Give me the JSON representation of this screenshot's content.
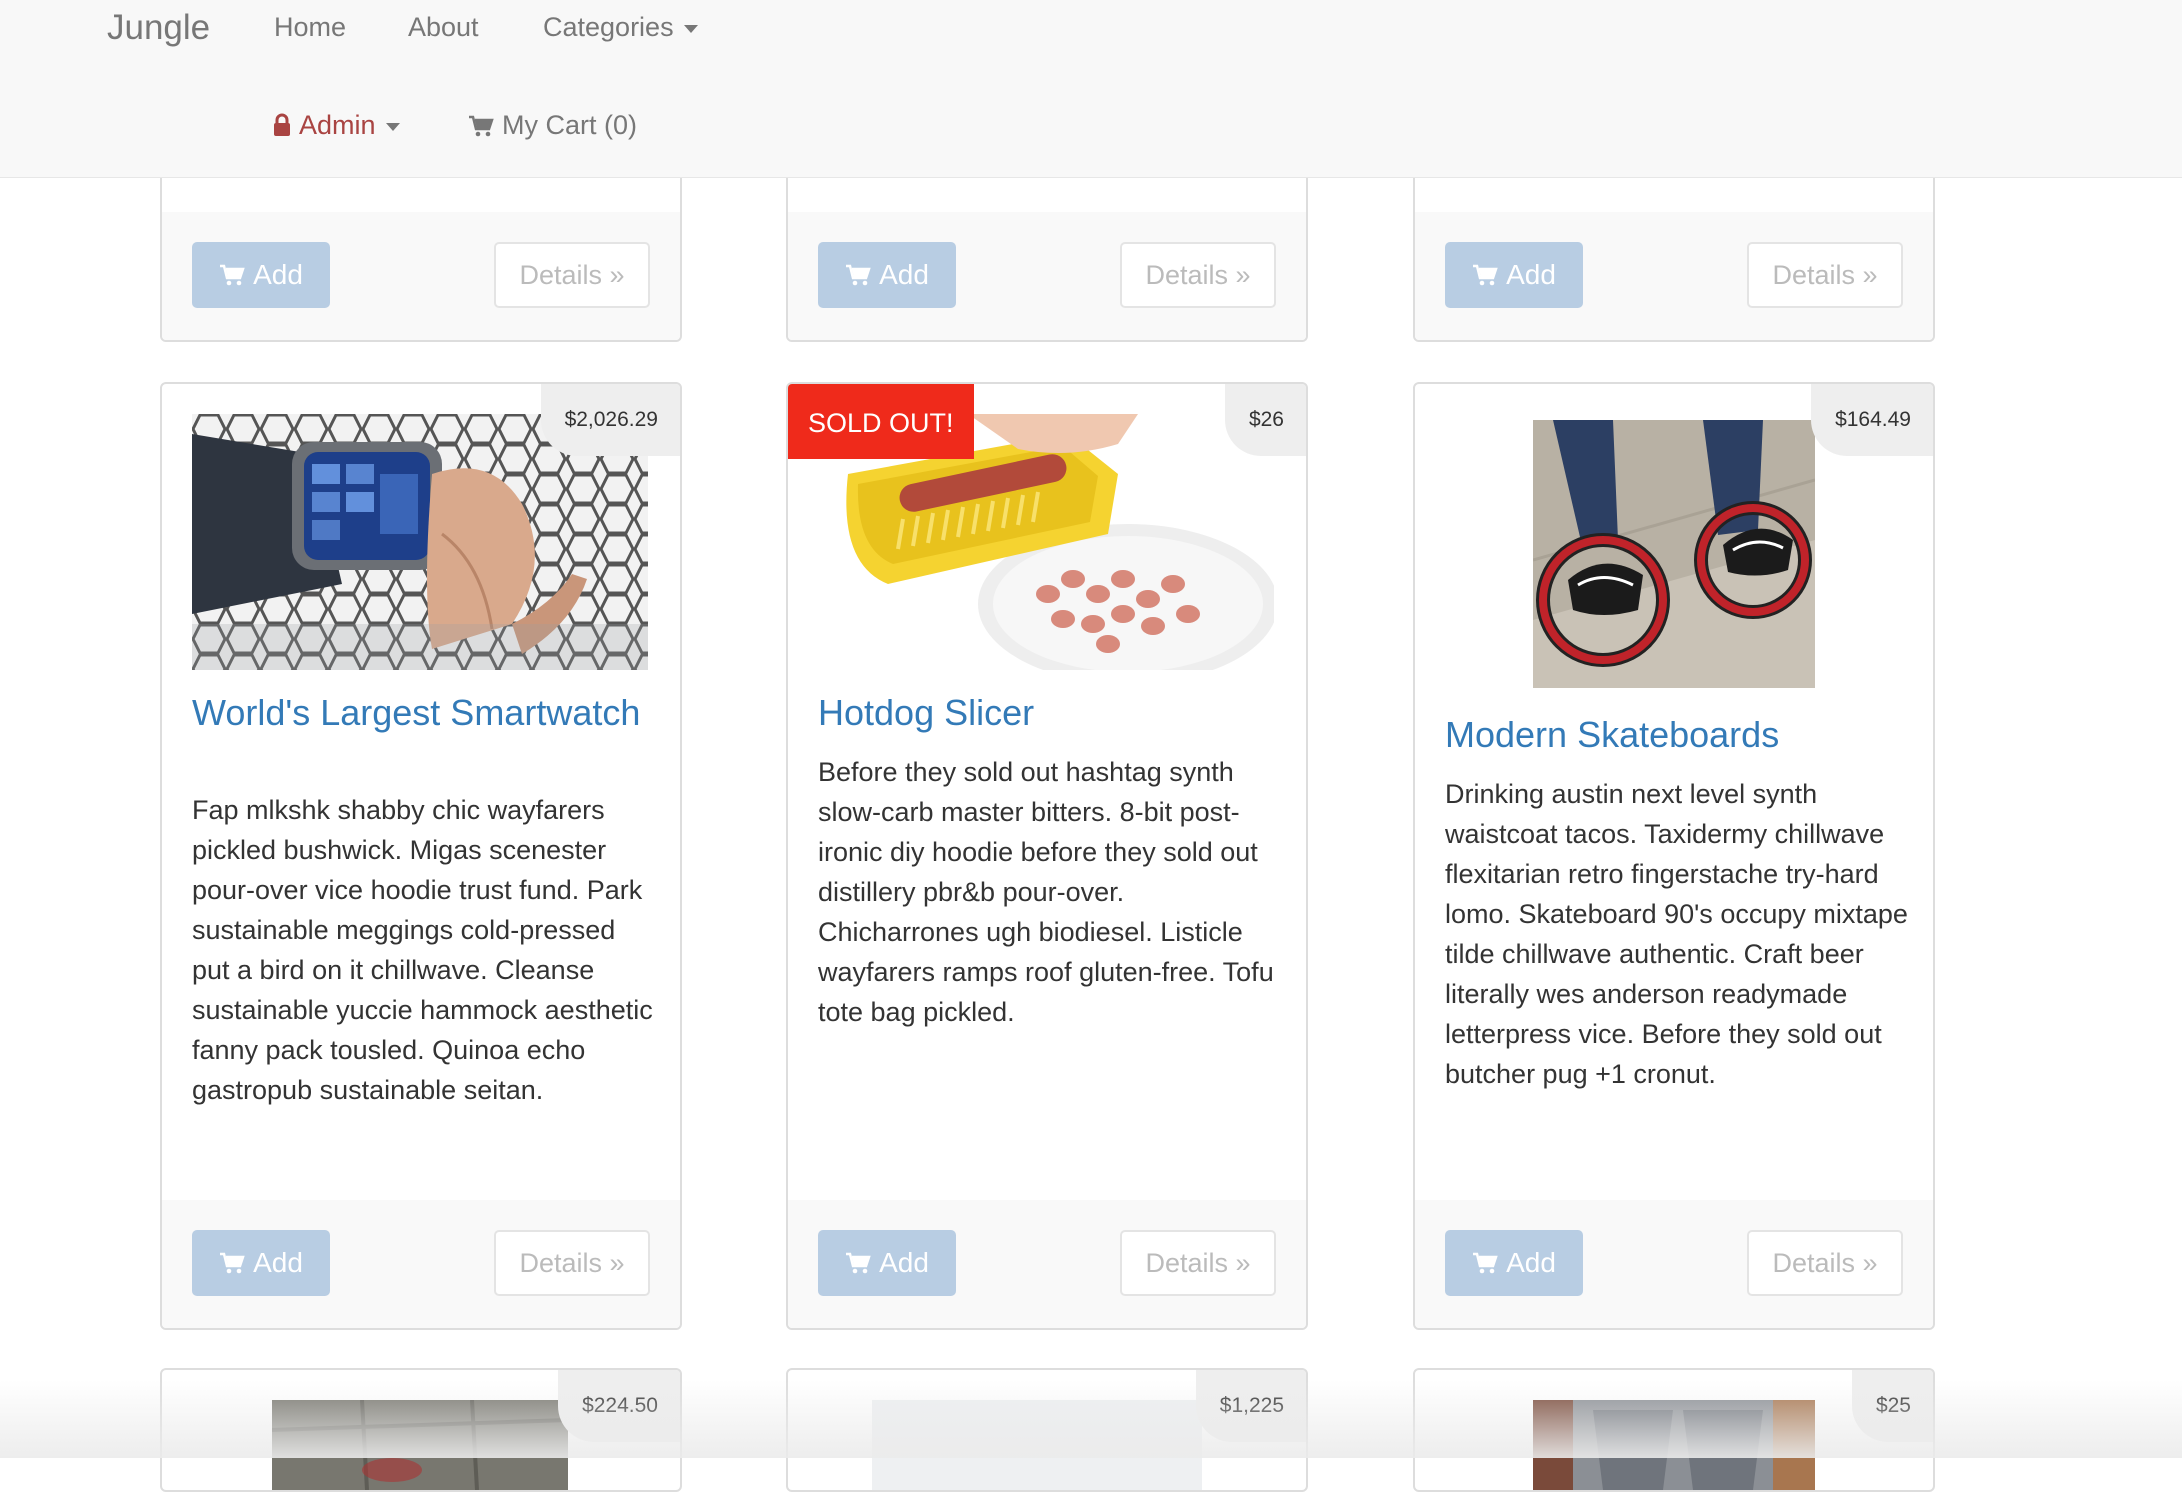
{
  "navbar": {
    "brand": "Jungle",
    "home": "Home",
    "about": "About",
    "categories": "Categories",
    "admin": "Admin",
    "cart": "My Cart (0)"
  },
  "buttons": {
    "add": "Add",
    "details": "Details »"
  },
  "products": [
    {
      "title": "World's Largest Smartwatch",
      "price": "$2,026.29",
      "sold_out": false,
      "description": "Fap mlkshk shabby chic wayfarers pickled bushwick. Migas scenester pour-over vice hoodie trust fund. Park sustainable meggings cold-pressed put a bird on it chillwave. Cleanse sustainable yuccie hammock aesthetic fanny pack tousled. Quinoa echo gastropub sustainable seitan.",
      "image": "smartwatch-on-wrist"
    },
    {
      "title": "Hotdog Slicer",
      "price": "$26",
      "sold_out": true,
      "sold_label": "SOLD OUT!",
      "description": "Before they sold out hashtag synth slow-carb master bitters. 8-bit post-ironic diy hoodie before they sold out distillery pbr&b pour-over. Chicharrones ugh biodiesel. Listicle wayfarers ramps roof gluten-free. Tofu tote bag pickled.",
      "image": "hotdog-slicer-with-plate"
    },
    {
      "title": "Modern Skateboards",
      "price": "$164.49",
      "sold_out": false,
      "description": "Drinking austin next level synth waistcoat tacos. Taxidermy chillwave flexitarian retro fingerstache try-hard lomo. Skateboard 90's occupy mixtape tilde chillwave authentic. Craft beer literally wes anderson readymade letterpress vice. Before they sold out butcher pug +1 cronut.",
      "image": "orbital-wheel-skates"
    }
  ],
  "next_row_prices": [
    "$224.50",
    "$1,225",
    "$25"
  ]
}
